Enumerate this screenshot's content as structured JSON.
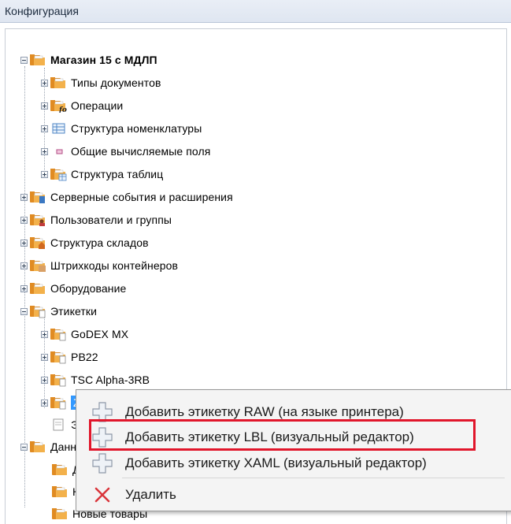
{
  "panel": {
    "title": "Конфигурация"
  },
  "tree": {
    "root": {
      "label": "Магазин 15 с МДЛП"
    },
    "store_children": [
      {
        "label": "Типы документов"
      },
      {
        "label": "Операции"
      },
      {
        "label": "Структура номенклатуры"
      },
      {
        "label": "Общие вычисляемые поля"
      },
      {
        "label": "Структура таблиц"
      }
    ],
    "top_level": [
      {
        "label": "Серверные события и расширения"
      },
      {
        "label": "Пользователи и группы"
      },
      {
        "label": "Структура складов"
      },
      {
        "label": "Штрихкоды контейнеров"
      },
      {
        "label": "Оборудование"
      },
      {
        "label": "Этикетки"
      }
    ],
    "labels_children": [
      {
        "label": "GoDEX MX"
      },
      {
        "label": "PB22"
      },
      {
        "label": "TSC Alpha-3RB"
      },
      {
        "label": "Z"
      },
      {
        "label": "Э"
      }
    ],
    "data_node": {
      "label": "Данн"
    },
    "data_children": [
      {
        "label": "Д"
      },
      {
        "label": "Н"
      },
      {
        "label": "Новые товары"
      }
    ]
  },
  "context_menu": {
    "items": [
      {
        "label": "Добавить этикетку RAW (на языке принтера)",
        "icon": "add-icon"
      },
      {
        "label": "Добавить этикетку LBL (визуальный редактор)",
        "icon": "add-icon"
      },
      {
        "label": "Добавить этикетку XAML (визуальный редактор)",
        "icon": "add-icon"
      },
      {
        "label": "Удалить",
        "icon": "delete-icon"
      }
    ]
  },
  "colors": {
    "highlight": "#e1162b",
    "selection": "#3399ff",
    "folder": "#e39a2f"
  }
}
